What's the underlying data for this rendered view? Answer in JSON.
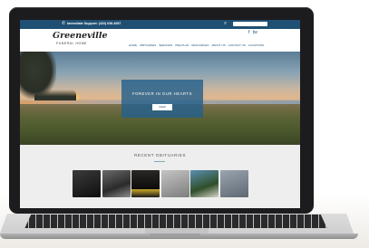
{
  "topbar": {
    "support_text": "Immediate Support: (423) 638-4087",
    "phone_icon": "phone-icon",
    "search_icon": "search-icon",
    "search_placeholder": ""
  },
  "header": {
    "logo_script": "Greeneville",
    "logo_sub": "FUNERAL HOME",
    "social": [
      "f",
      "tw"
    ],
    "nav": [
      "HOME",
      "OBITUARIES",
      "SERVICES",
      "PRE-PLAN",
      "RESOURCES",
      "ABOUT US",
      "CONTACT US",
      "LOCATIONS"
    ]
  },
  "hero": {
    "title": "FOREVER IN OUR HEARTS",
    "button_label": "VIEW"
  },
  "tributes": {
    "heading": "RECENT OBITUARIES"
  },
  "colors": {
    "brand_blue": "#1f4f73",
    "card_blue": "#24608c"
  }
}
